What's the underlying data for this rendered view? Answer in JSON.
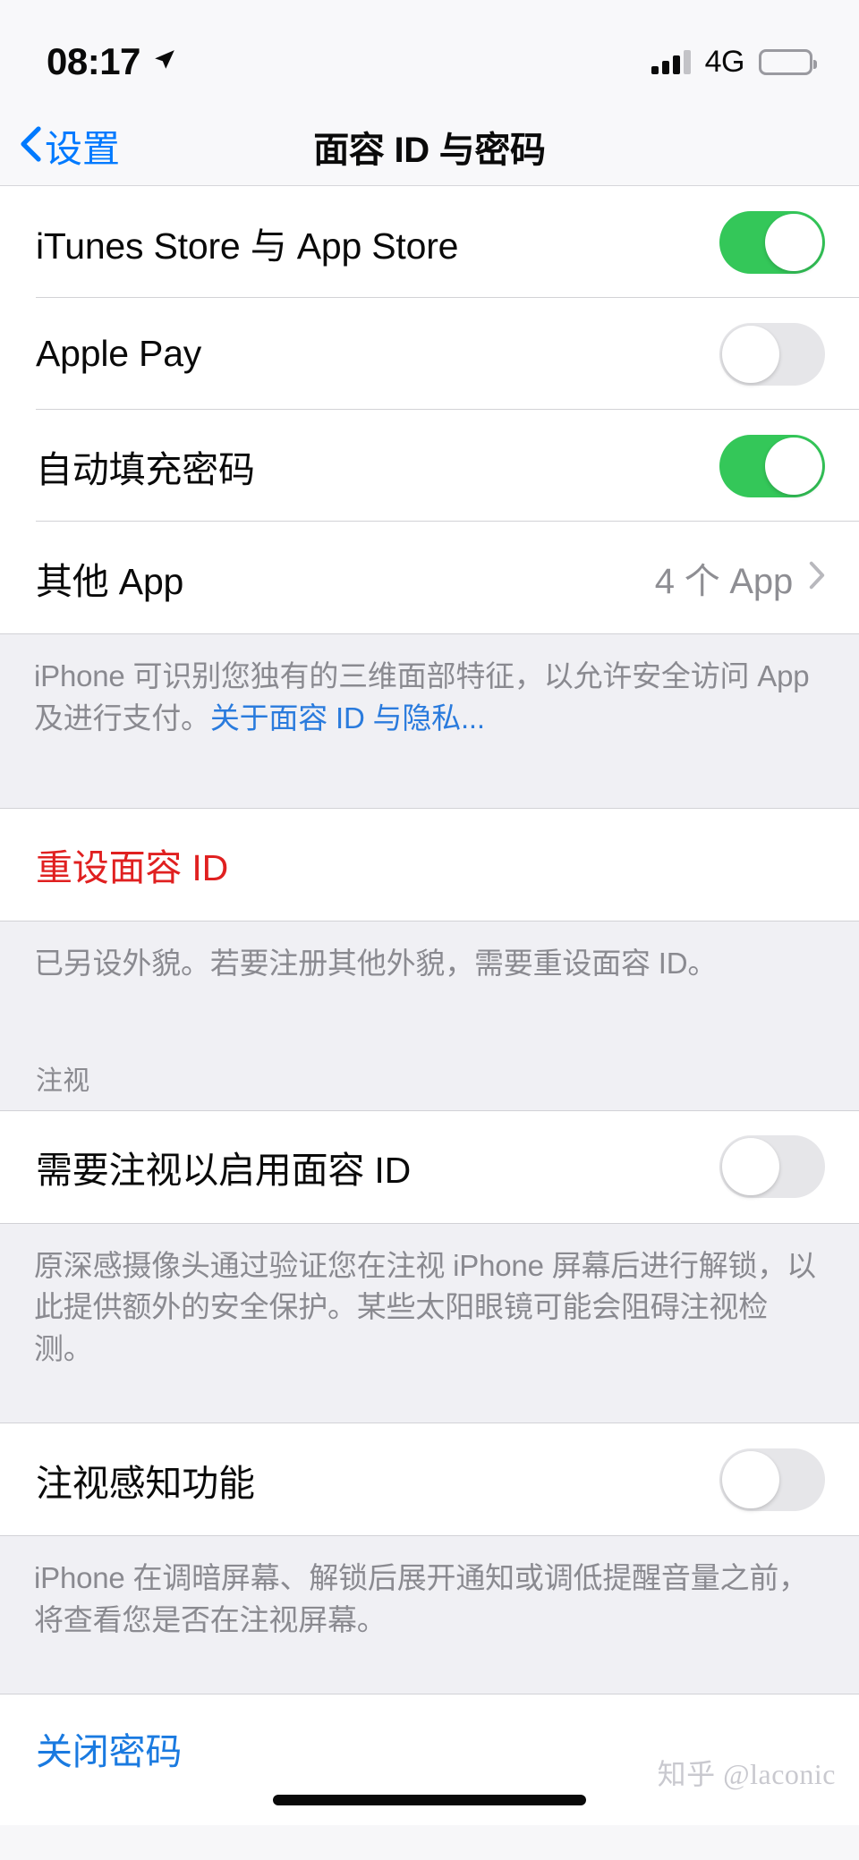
{
  "status_bar": {
    "time": "08:17",
    "location_icon": "location-arrow-icon",
    "signal_icon": "cellular-signal-icon",
    "network": "4G",
    "battery_icon": "battery-full-icon"
  },
  "nav": {
    "back_label": "设置",
    "back_icon": "chevron-left-icon",
    "title": "面容 ID 与密码"
  },
  "colors": {
    "accent_blue": "#007aff",
    "toggle_on_green": "#34c759",
    "destructive_red": "#e02020",
    "link_blue": "#2a7bdd",
    "group_background": "#f0f0f4"
  },
  "sections": [
    {
      "rows": [
        {
          "label": "iTunes Store 与 App Store",
          "control": "toggle",
          "state": "on"
        },
        {
          "label": "Apple Pay",
          "control": "toggle",
          "state": "off"
        },
        {
          "label": "自动填充密码",
          "control": "toggle",
          "state": "on"
        },
        {
          "label": "其他 App",
          "control": "disclosure",
          "value": "4 个 App",
          "chevron_icon": "chevron-right-icon"
        }
      ],
      "footer": {
        "text": "iPhone 可识别您独有的三维面部特征，以允许安全访问 App 及进行支付。",
        "link": "关于面容 ID 与隐私..."
      }
    },
    {
      "rows": [
        {
          "label": "重设面容 ID",
          "control": "none",
          "style": "destructive"
        }
      ],
      "footer": {
        "text": "已另设外貌。若要注册其他外貌，需要重设面容 ID。",
        "link": ""
      }
    },
    {
      "header": "注视",
      "rows": [
        {
          "label": "需要注视以启用面容 ID",
          "control": "toggle",
          "state": "off"
        }
      ],
      "footer": {
        "text": "原深感摄像头通过验证您在注视 iPhone 屏幕后进行解锁，以此提供额外的安全保护。某些太阳眼镜可能会阻碍注视检测。",
        "link": ""
      }
    },
    {
      "rows": [
        {
          "label": "注视感知功能",
          "control": "toggle",
          "state": "off"
        }
      ],
      "footer": {
        "text": "iPhone 在调暗屏幕、解锁后展开通知或调低提醒音量之前，将查看您是否在注视屏幕。",
        "link": ""
      }
    },
    {
      "rows": [
        {
          "label": "关闭密码",
          "control": "none",
          "style": "action"
        }
      ]
    }
  ],
  "watermark": "知乎 @laconic"
}
